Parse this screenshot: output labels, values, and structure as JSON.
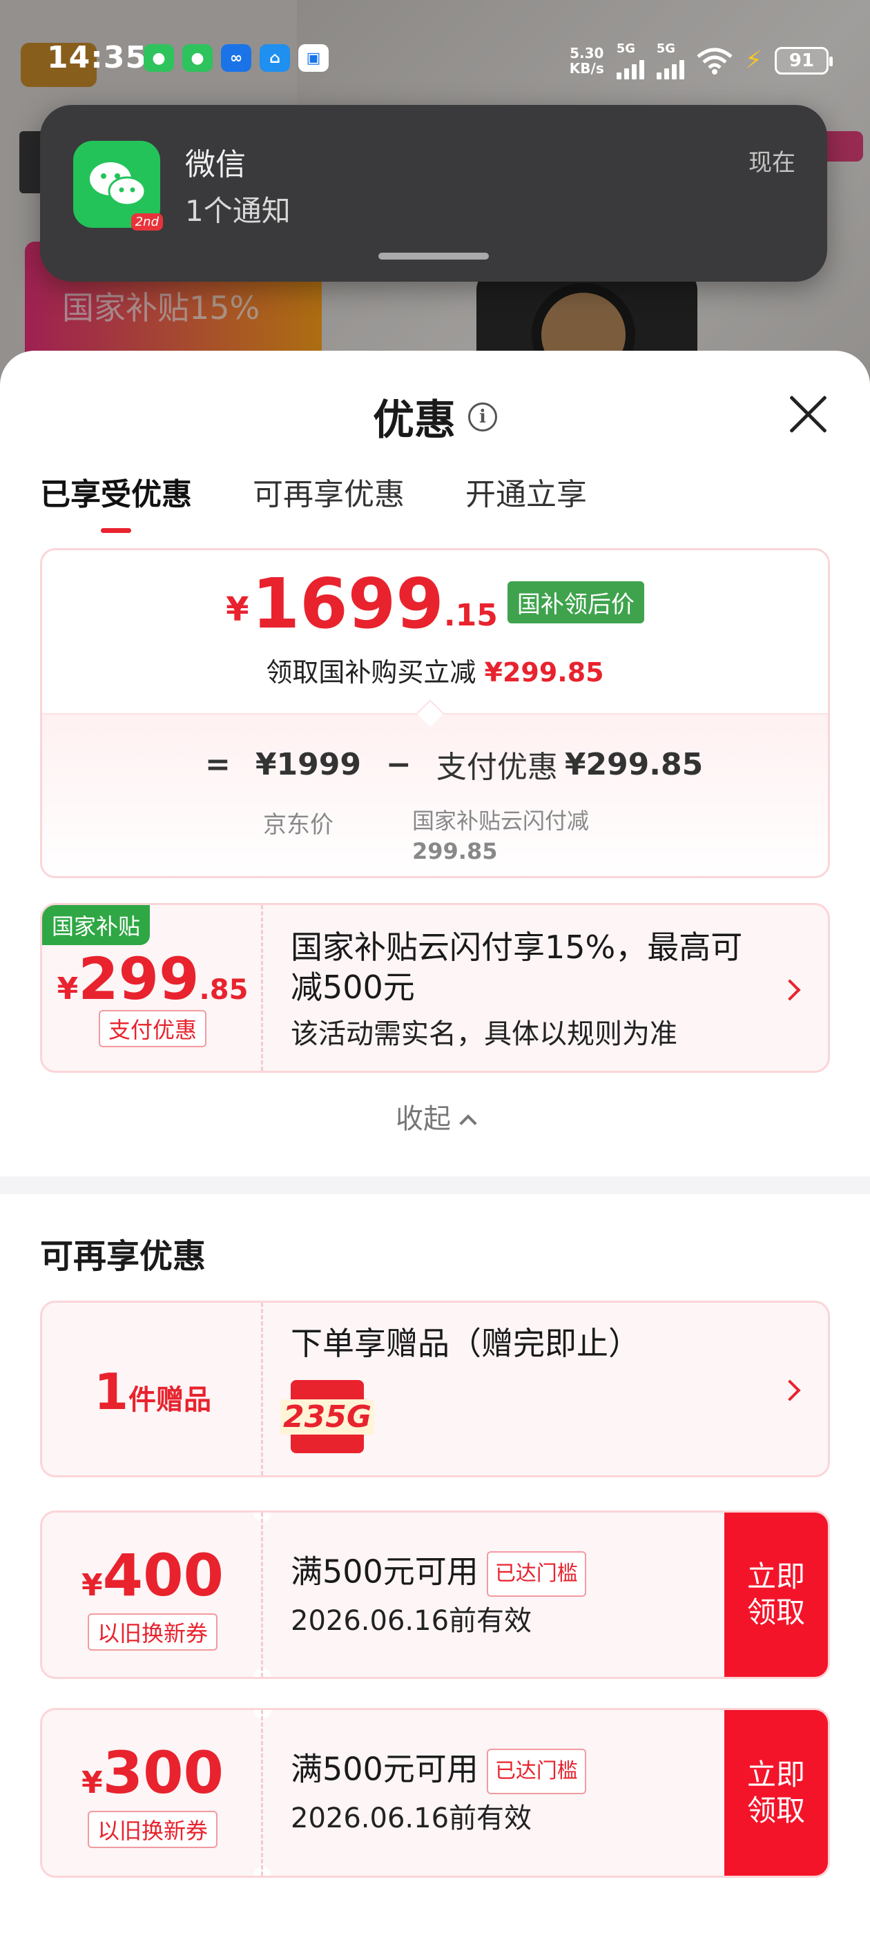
{
  "status_bar": {
    "time": "14:35",
    "speed_value": "5.30",
    "speed_unit": "KB/s",
    "network_1": "5G",
    "network_2": "5G",
    "battery": "91"
  },
  "background": {
    "promo_text": "国家补贴15%"
  },
  "notification": {
    "app_name": "微信",
    "message": "1个通知",
    "time": "现在",
    "badge": "2nd"
  },
  "sheet": {
    "title": "优惠",
    "tabs": [
      "已享受优惠",
      "可再享优惠",
      "开通立享"
    ],
    "price_card": {
      "yen": "¥",
      "price_int": "1699",
      "price_dec": ".15",
      "tag": "国补领后价",
      "subtitle_prefix": "领取国补购买立减",
      "subtitle_amount": "¥299.85",
      "equals": "=",
      "jd_price": "¥1999",
      "minus": "−",
      "pay_discount_label": "支付优惠",
      "pay_discount_value": "¥299.85",
      "jd_price_caption": "京东价",
      "pay_caption_line1": "国家补贴云闪付减",
      "pay_caption_line2": "299.85"
    },
    "subsidy_coupon": {
      "badge": "国家补贴",
      "yen": "¥",
      "amount_int": "299",
      "amount_dec": ".85",
      "tag": "支付优惠",
      "title": "国家补贴云闪付享15%，最高可减500元",
      "desc": "该活动需实名，具体以规则为准"
    },
    "collapse_label": "收起",
    "section_title": "可再享优惠",
    "gift_coupon": {
      "count": "1",
      "unit": "件赠品",
      "title": "下单享赠品（赠完即止）",
      "gift_image_text": "235G"
    },
    "coupons": [
      {
        "yen": "¥",
        "amount": "400",
        "tag": "以旧换新券",
        "condition": "满500元可用",
        "threshold": "已达门槛",
        "validity": "2026.06.16前有效",
        "button_line1": "立即",
        "button_line2": "领取"
      },
      {
        "yen": "¥",
        "amount": "300",
        "tag": "以旧换新券",
        "condition": "满500元可用",
        "threshold": "已达门槛",
        "validity": "2026.06.16前有效",
        "button_line1": "立即",
        "button_line2": "领取"
      }
    ]
  },
  "colors": {
    "accent_red": "#e8232e",
    "subsidy_green": "#2fa744",
    "claim_button": "#f4142a"
  }
}
